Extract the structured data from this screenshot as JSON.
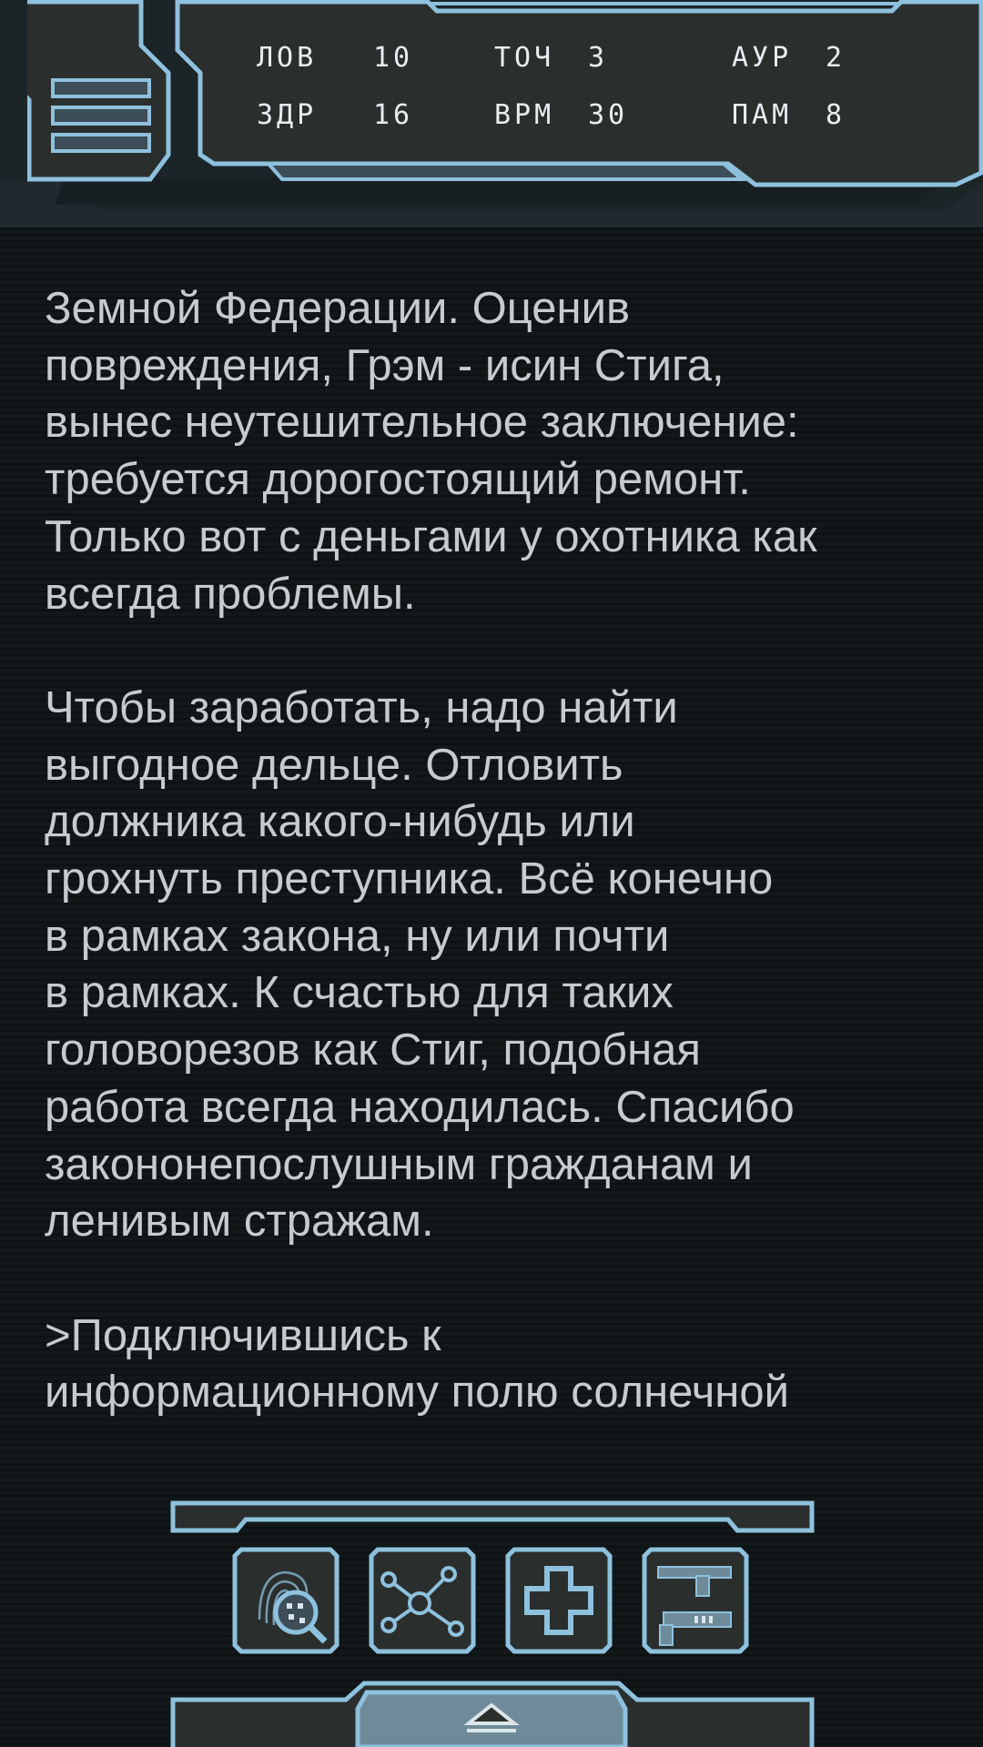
{
  "stats": {
    "row1": [
      {
        "label": "ЛОВ",
        "value": "10"
      },
      {
        "label": "ТОЧ",
        "value": "3"
      },
      {
        "label": "АУР",
        "value": "2"
      }
    ],
    "row2": [
      {
        "label": "ЗДР",
        "value": "16"
      },
      {
        "label": "ВРМ",
        "value": "30"
      },
      {
        "label": "ПАМ",
        "value": "8"
      }
    ]
  },
  "story": {
    "paragraphs": [
      "Земной Федерации. Оценив\nповреждения, Грэм - исин Стига,\nвынес неутешительное заключение:\nтребуется дорогостоящий ремонт.\nТолько вот с деньгами у охотника как\nвсегда проблемы.",
      "Чтобы заработать, надо найти\nвыгодное дельце. Отловить\nдолжника какого-нибудь или\nгрохнуть преступника. Всё конечно\nв рамках закона, ну или почти\nв рамках. К счастью для таких\nголоворезов как Стиг, подобная\nработа всегда находилась. Спасибо\nзакононепослушным гражданам и\nленивым стражам.",
      ">Подключившись к\nинформационному полю солнечной"
    ]
  },
  "toolbar": {
    "buttons": [
      {
        "icon": "fingerprint-magnifier-icon"
      },
      {
        "icon": "node-network-icon"
      },
      {
        "icon": "medical-cross-icon"
      },
      {
        "icon": "weapons-icon"
      }
    ]
  },
  "colors": {
    "background": "#111719",
    "frame_fill": "#2a2f2e",
    "frame_stroke": "#8ec1dd",
    "frame_dark": "#3d4e58",
    "text": "#c5cbcf",
    "stat_text": "#e8eef0"
  }
}
